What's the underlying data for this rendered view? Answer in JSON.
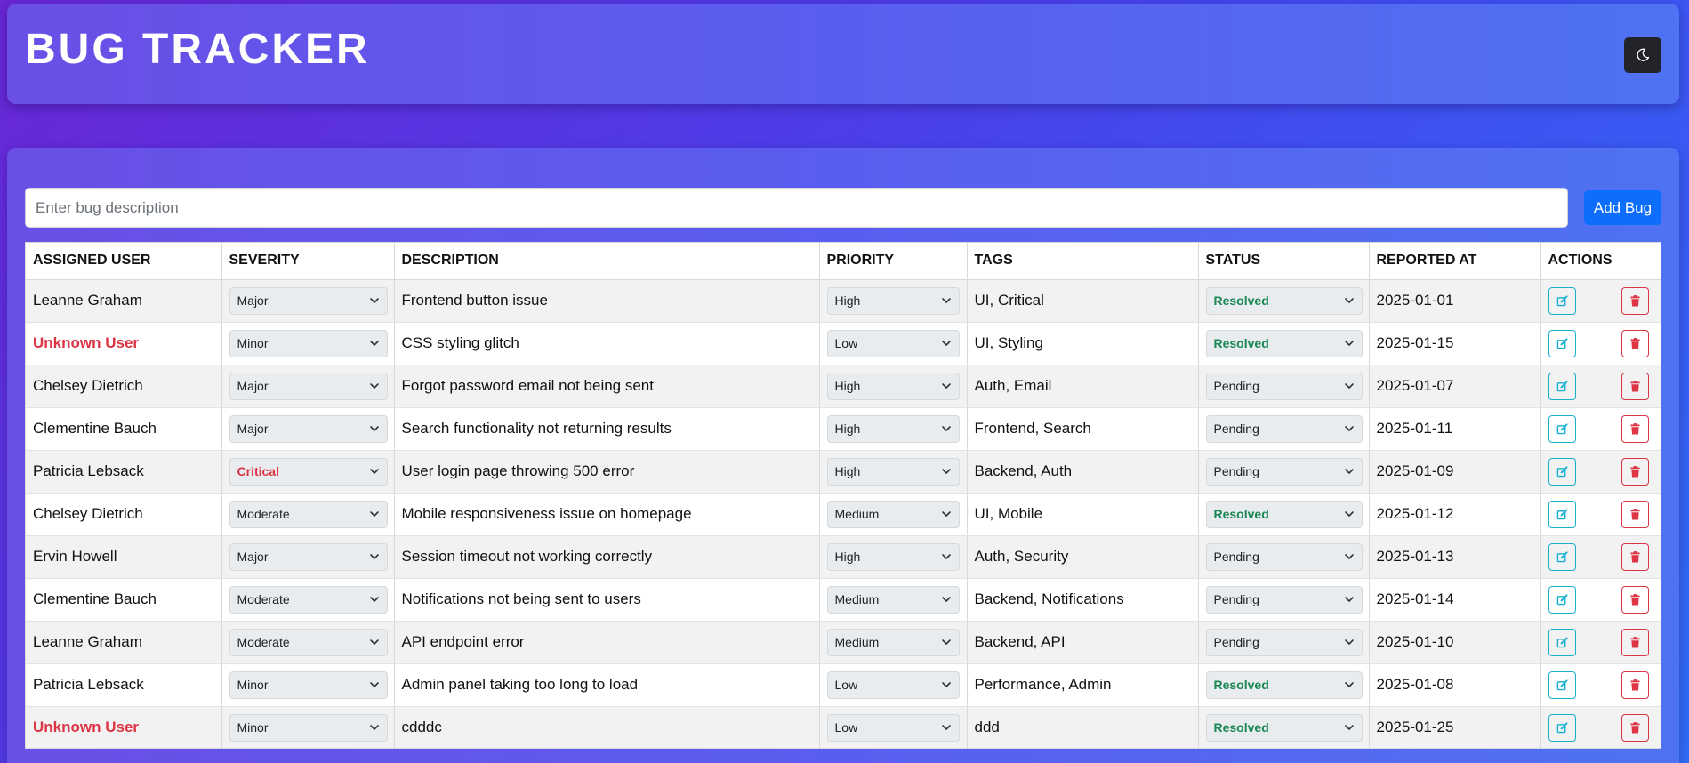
{
  "header": {
    "title": "BUG TRACKER",
    "theme_toggle_icon": "moon-icon"
  },
  "form": {
    "placeholder": "Enter bug description",
    "add_label": "Add Bug"
  },
  "table": {
    "columns": [
      "ASSIGNED USER",
      "SEVERITY",
      "DESCRIPTION",
      "PRIORITY",
      "TAGS",
      "STATUS",
      "REPORTED AT",
      "ACTIONS"
    ],
    "rows": [
      {
        "user": "Leanne Graham",
        "unknown": false,
        "severity": "Major",
        "description": "Frontend button issue",
        "priority": "High",
        "tags": "UI, Critical",
        "status": "Resolved",
        "reported": "2025-01-01"
      },
      {
        "user": "Unknown User",
        "unknown": true,
        "severity": "Minor",
        "description": "CSS styling glitch",
        "priority": "Low",
        "tags": "UI, Styling",
        "status": "Resolved",
        "reported": "2025-01-15"
      },
      {
        "user": "Chelsey Dietrich",
        "unknown": false,
        "severity": "Major",
        "description": "Forgot password email not being sent",
        "priority": "High",
        "tags": "Auth, Email",
        "status": "Pending",
        "reported": "2025-01-07"
      },
      {
        "user": "Clementine Bauch",
        "unknown": false,
        "severity": "Major",
        "description": "Search functionality not returning results",
        "priority": "High",
        "tags": "Frontend, Search",
        "status": "Pending",
        "reported": "2025-01-11"
      },
      {
        "user": "Patricia Lebsack",
        "unknown": false,
        "severity": "Critical",
        "description": "User login page throwing 500 error",
        "priority": "High",
        "tags": "Backend, Auth",
        "status": "Pending",
        "reported": "2025-01-09"
      },
      {
        "user": "Chelsey Dietrich",
        "unknown": false,
        "severity": "Moderate",
        "description": "Mobile responsiveness issue on homepage",
        "priority": "Medium",
        "tags": "UI, Mobile",
        "status": "Resolved",
        "reported": "2025-01-12"
      },
      {
        "user": "Ervin Howell",
        "unknown": false,
        "severity": "Major",
        "description": "Session timeout not working correctly",
        "priority": "High",
        "tags": "Auth, Security",
        "status": "Pending",
        "reported": "2025-01-13"
      },
      {
        "user": "Clementine Bauch",
        "unknown": false,
        "severity": "Moderate",
        "description": "Notifications not being sent to users",
        "priority": "Medium",
        "tags": "Backend, Notifications",
        "status": "Pending",
        "reported": "2025-01-14"
      },
      {
        "user": "Leanne Graham",
        "unknown": false,
        "severity": "Moderate",
        "description": "API endpoint error",
        "priority": "Medium",
        "tags": "Backend, API",
        "status": "Pending",
        "reported": "2025-01-10"
      },
      {
        "user": "Patricia Lebsack",
        "unknown": false,
        "severity": "Minor",
        "description": "Admin panel taking too long to load",
        "priority": "Low",
        "tags": "Performance, Admin",
        "status": "Resolved",
        "reported": "2025-01-08"
      },
      {
        "user": "Unknown User",
        "unknown": true,
        "severity": "Minor",
        "description": "cdddc",
        "priority": "Low",
        "tags": "ddd",
        "status": "Resolved",
        "reported": "2025-01-25"
      }
    ]
  },
  "colors": {
    "accent": "#0d6efd",
    "danger": "#dc3545",
    "success": "#198754",
    "info": "#17b1d0"
  },
  "icons": {
    "edit": "edit-icon",
    "delete": "trash-icon",
    "dropdown": "chevron-down-icon"
  }
}
